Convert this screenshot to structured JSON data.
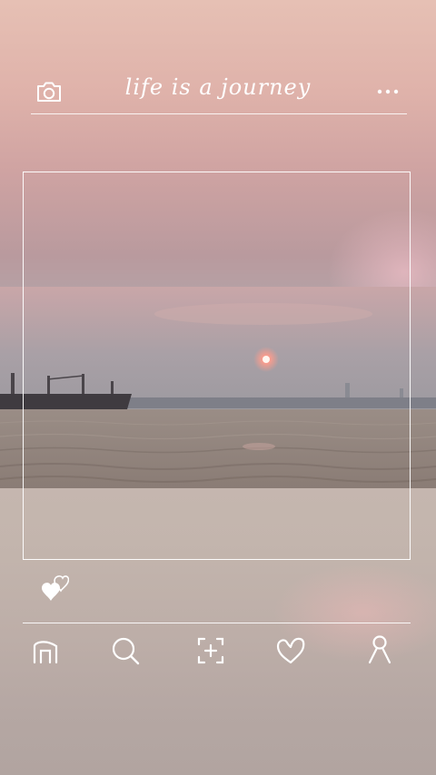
{
  "header": {
    "title": "life is a journey",
    "camera_icon": "camera-icon",
    "more_icon": "more-dots-icon"
  },
  "post": {
    "photo_subject": "sunset-over-river-with-cargo-ship",
    "like_icon": "hearts-icon"
  },
  "bottom_nav": {
    "items": [
      {
        "icon": "home-icon"
      },
      {
        "icon": "search-icon"
      },
      {
        "icon": "add-post-icon"
      },
      {
        "icon": "heart-icon"
      },
      {
        "icon": "profile-icon"
      }
    ]
  },
  "colors": {
    "accent": "#ffffff",
    "sky_top": "#e6c0b4",
    "sun": "#ffb3a8",
    "water": "#8a7b72"
  }
}
